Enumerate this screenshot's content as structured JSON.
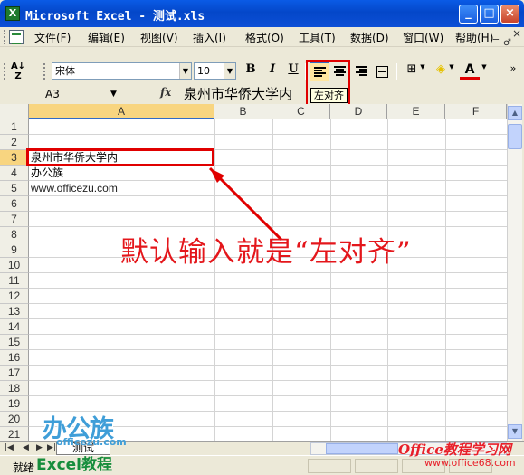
{
  "window": {
    "title": "Microsoft Excel - 测试.xls",
    "app_icon": "excel-icon",
    "buttons": [
      "_",
      "□",
      "×"
    ]
  },
  "menu": {
    "items": [
      "文件(F)",
      "编辑(E)",
      "视图(V)",
      "插入(I)",
      "格式(O)",
      "工具(T)",
      "数据(D)",
      "窗口(W)",
      "帮助(H)"
    ],
    "window_controls": [
      "_",
      "♂",
      "×"
    ]
  },
  "format_toolbar": {
    "font": "宋体",
    "size": "10",
    "bold": "B",
    "italic": "I",
    "underline": "U",
    "font_color_label": "A",
    "tooltip": "左对齐"
  },
  "formula_bar": {
    "name_box": "A3",
    "fx": "fx",
    "value": "泉州市华侨大学内"
  },
  "grid": {
    "columns": [
      "A",
      "B",
      "C",
      "D",
      "E",
      "F"
    ],
    "rows": [
      "1",
      "2",
      "3",
      "4",
      "5",
      "6",
      "7",
      "8",
      "9",
      "10",
      "11",
      "12",
      "13",
      "14",
      "15",
      "16",
      "17",
      "18",
      "19",
      "20",
      "21"
    ],
    "cells": {
      "A3": "泉州市华侨大学内",
      "A4": "办公族",
      "A5": "www.officezu.com"
    }
  },
  "annotation": "默认输入就是“左对齐”",
  "sheet_tabs": [
    "测试"
  ],
  "status": "就绪",
  "watermarks": {
    "left_logo": "办公族",
    "left_logo_url": "officezu.com",
    "left_caption": "Excel教程",
    "right_logo": "Office教程学习网",
    "right_url": "www.office68.com"
  }
}
